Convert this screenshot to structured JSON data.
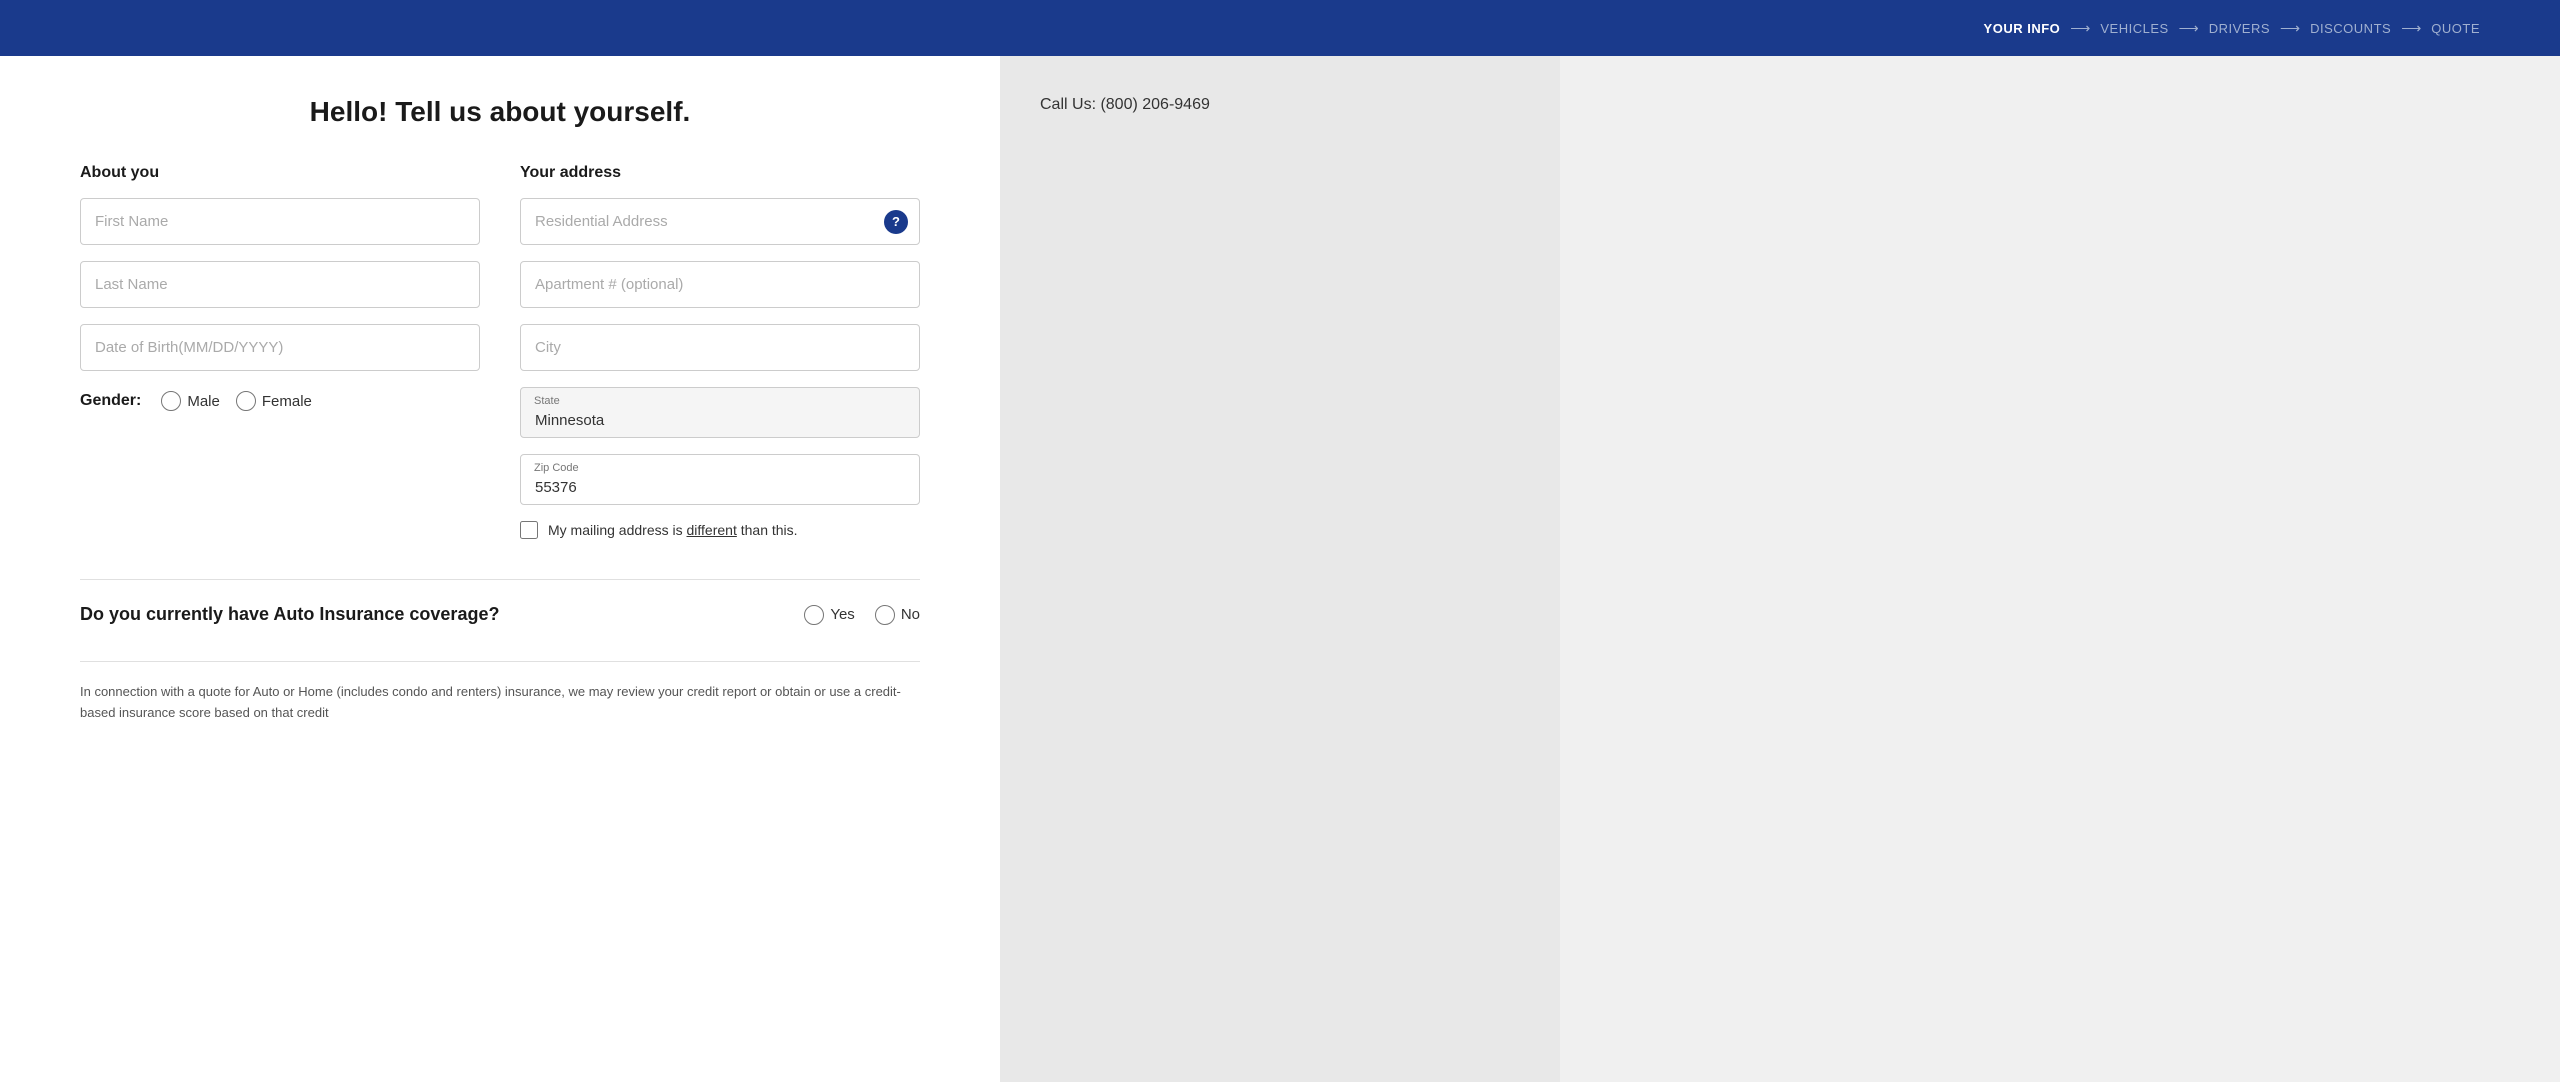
{
  "nav": {
    "steps": [
      {
        "label": "YOUR INFO",
        "active": true
      },
      {
        "label": "VEHICLES",
        "active": false
      },
      {
        "label": "DRIVERS",
        "active": false
      },
      {
        "label": "DISCOUNTS",
        "active": false
      },
      {
        "label": "QUOTE",
        "active": false
      }
    ]
  },
  "page": {
    "title": "Hello! Tell us about yourself."
  },
  "about_you": {
    "heading": "About you",
    "first_name_placeholder": "First Name",
    "last_name_placeholder": "Last Name",
    "dob_placeholder": "Date of Birth(MM/DD/YYYY)",
    "gender_label": "Gender:",
    "gender_male": "Male",
    "gender_female": "Female"
  },
  "your_address": {
    "heading": "Your address",
    "residential_placeholder": "Residential Address",
    "apt_placeholder": "Apartment # (optional)",
    "city_placeholder": "City",
    "state_label": "State",
    "state_value": "Minnesota",
    "zip_label": "Zip Code",
    "zip_value": "55376",
    "mailing_text_part1": "My mailing address is ",
    "mailing_text_link": "different",
    "mailing_text_part2": " than this."
  },
  "auto_insurance": {
    "question": "Do you currently have Auto Insurance coverage?",
    "yes_label": "Yes",
    "no_label": "No"
  },
  "disclaimer": {
    "text": "In connection with a quote for Auto or Home (includes condo and renters) insurance, we may review your credit report or obtain or use a credit-based insurance score based on that credit"
  },
  "sidebar": {
    "call_us": "Call Us: (800) 206-9469"
  }
}
